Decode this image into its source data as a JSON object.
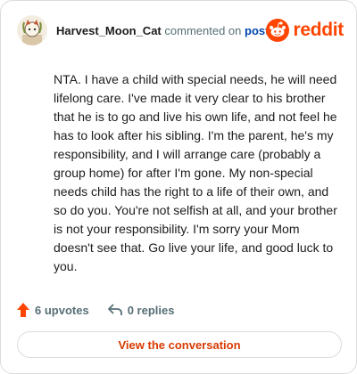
{
  "header": {
    "username": "Harvest_Moon_Cat",
    "meta_text": "commented on",
    "post_link": "post",
    "brand": "reddit"
  },
  "comment": {
    "text": "NTA. I have a child with special needs, he will need lifelong care. I've made it very clear to his brother that he is to go and live his own life, and not feel he has to look after his sibling. I'm the parent, he's my responsibility, and I will arrange care (probably a group home) for after I'm gone. My non-special needs child has the right to a life of their own, and so do you. You're not selfish at all, and your brother is not your responsibility. I'm sorry your Mom doesn't see that. Go live your life, and good luck to you."
  },
  "actions": {
    "upvotes": "6 upvotes",
    "replies": "0 replies"
  },
  "cta": {
    "label": "View the conversation"
  },
  "colors": {
    "brand": "#ff4500",
    "link": "#0045ac",
    "cta": "#d93a00",
    "muted": "#576f76"
  },
  "icons": {
    "avatar": "user-avatar",
    "logo": "reddit-snoo-icon",
    "upvote": "upvote-arrow-icon",
    "reply": "reply-arrow-icon"
  }
}
